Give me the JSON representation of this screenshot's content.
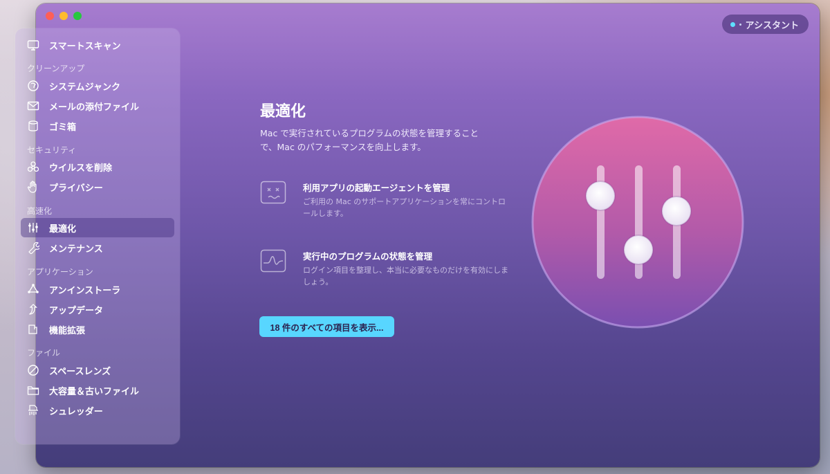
{
  "window": {
    "traffic_lights": [
      "close",
      "minimize",
      "zoom"
    ]
  },
  "toolbar": {
    "assistant_label": "アシスタント"
  },
  "sidebar": {
    "smart_scan": "スマートスキャン",
    "sections": {
      "cleanup": "クリーンアップ",
      "security": "セキュリティ",
      "speed": "高速化",
      "applications": "アプリケーション",
      "files": "ファイル"
    },
    "items": {
      "system_junk": "システムジャンク",
      "mail_attachments": "メールの添付ファイル",
      "trash": "ゴミ箱",
      "malware_removal": "ウイルスを削除",
      "privacy": "プライバシー",
      "optimization": "最適化",
      "maintenance": "メンテナンス",
      "uninstaller": "アンインストーラ",
      "updater": "アップデータ",
      "extensions": "機能拡張",
      "space_lens": "スペースレンズ",
      "large_old_files": "大容量＆古いファイル",
      "shredder": "シュレッダー"
    },
    "active_item": "optimization"
  },
  "main": {
    "title": "最適化",
    "description": "Mac で実行されているプログラムの状態を管理することで、Mac のパフォーマンスを向上します。",
    "features": [
      {
        "icon": "dizzy-face-icon",
        "title": "利用アプリの起動エージェントを管理",
        "description": "ご利用の Mac のサポートアプリケーションを常にコントロールします。"
      },
      {
        "icon": "activity-graph-icon",
        "title": "実行中のプログラムの状態を管理",
        "description": "ログイン項目を整理し、本当に必要なものだけを有効にしましょう。"
      }
    ],
    "cta_label": "18 件のすべての項目を表示...",
    "hero_icon": "sliders-icon"
  },
  "colors": {
    "accent": "#58d6ff",
    "hero_top": "#e06aa8",
    "hero_bottom": "#7a4fb0"
  }
}
